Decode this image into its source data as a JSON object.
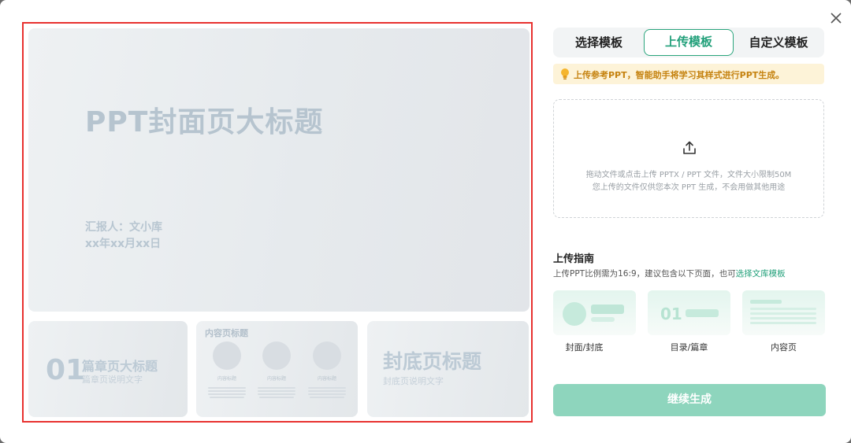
{
  "preview": {
    "cover": {
      "title": "PPT封面页大标题",
      "reporter": "汇报人：文小库",
      "date": "xx年xx月xx日"
    },
    "chapter": {
      "number": "01",
      "title": "篇章页大标题",
      "subtitle": "篇章页说明文字"
    },
    "content": {
      "title": "内容页标题",
      "column_label": "内容标题"
    },
    "back": {
      "title": "封底页标题",
      "subtitle": "封底页说明文字"
    }
  },
  "tabs": [
    {
      "label": "选择模板"
    },
    {
      "label": "上传模板"
    },
    {
      "label": "自定义模板"
    }
  ],
  "notice": {
    "text": "上传参考PPT，智能助手将学习其样式进行PPT生成。"
  },
  "dropzone": {
    "line1": "拖动文件或点击上传 PPTX / PPT 文件，文件大小限制50M",
    "line2": "您上传的文件仅供您本次 PPT 生成，不会用做其他用途"
  },
  "guide": {
    "title": "上传指南",
    "description": "上传PPT比例需为16:9，建议包含以下页面，也可",
    "link": "选择文库模板",
    "cards": [
      {
        "label": "封面/封底"
      },
      {
        "label": "目录/篇章"
      },
      {
        "label": "内容页"
      }
    ],
    "card2_number": "01"
  },
  "generate_button": {
    "label": "继续生成"
  },
  "colors": {
    "accent": "#22a07a",
    "button_disabled": "#8ed5bd",
    "notice_bg": "#fdf3d8",
    "notice_text": "#c5820f",
    "highlight_border": "#e8312f"
  }
}
